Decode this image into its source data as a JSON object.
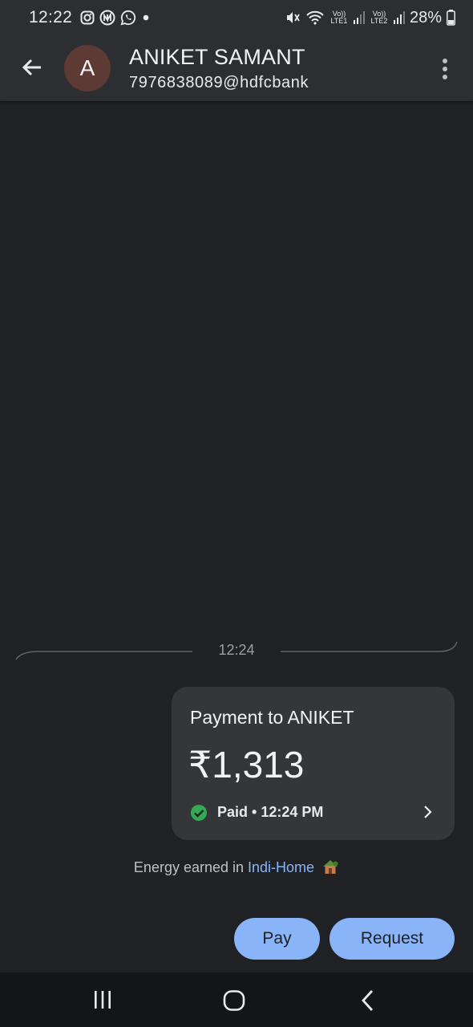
{
  "status_bar": {
    "time": "12:22",
    "notification_icons": [
      "instagram-icon",
      "chat-app-icon",
      "whatsapp-icon",
      "dot-icon"
    ],
    "sim1_label": "Vo)) LTE1",
    "sim2_label": "Vo)) LTE2",
    "battery": "28%"
  },
  "header": {
    "avatar_initial": "A",
    "contact_name": "ANIKET SAMANT",
    "contact_upi": "7976838089@hdfcbank"
  },
  "timeline": {
    "divider_time": "12:24"
  },
  "payment_card": {
    "title": "Payment to ANIKET",
    "amount": "₹1,313",
    "status": "Paid • 12:24 PM",
    "status_color": "#34a853"
  },
  "energy_line": {
    "prefix": "Energy earned in ",
    "link": "Indi-Home"
  },
  "actions": {
    "pay_label": "Pay",
    "request_label": "Request",
    "accent_color": "#8ab4f8"
  }
}
